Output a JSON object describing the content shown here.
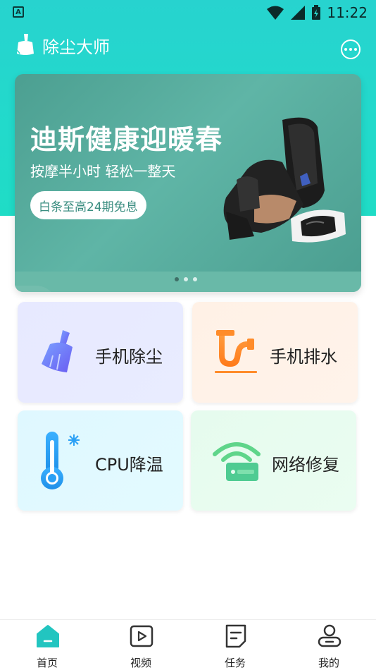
{
  "status_bar": {
    "time": "11:22",
    "notification_icon": "a-icon"
  },
  "header": {
    "title": "除尘大师",
    "logo_icon": "broom-icon",
    "message_icon": "chat-bubble-icon"
  },
  "banner": {
    "headline": "迪斯健康迎暖春",
    "subtitle": "按摩半小时 轻松一整天",
    "cta": "白条至高24期免息",
    "page_count": 3,
    "active_page": 1
  },
  "tiles": [
    {
      "label": "手机除尘",
      "icon": "broom-icon"
    },
    {
      "label": "手机排水",
      "icon": "pipe-icon"
    },
    {
      "label": "CPU降温",
      "icon": "thermometer-icon"
    },
    {
      "label": "网络修复",
      "icon": "wifi-router-icon"
    }
  ],
  "bottom_nav": [
    {
      "label": "首页",
      "icon": "home-icon",
      "active": true
    },
    {
      "label": "视频",
      "icon": "play-icon",
      "active": false
    },
    {
      "label": "任务",
      "icon": "task-icon",
      "active": false
    },
    {
      "label": "我的",
      "icon": "user-icon",
      "active": false
    }
  ],
  "colors": {
    "accent": "#22d3c8",
    "nav_active": "#22c5c0"
  }
}
